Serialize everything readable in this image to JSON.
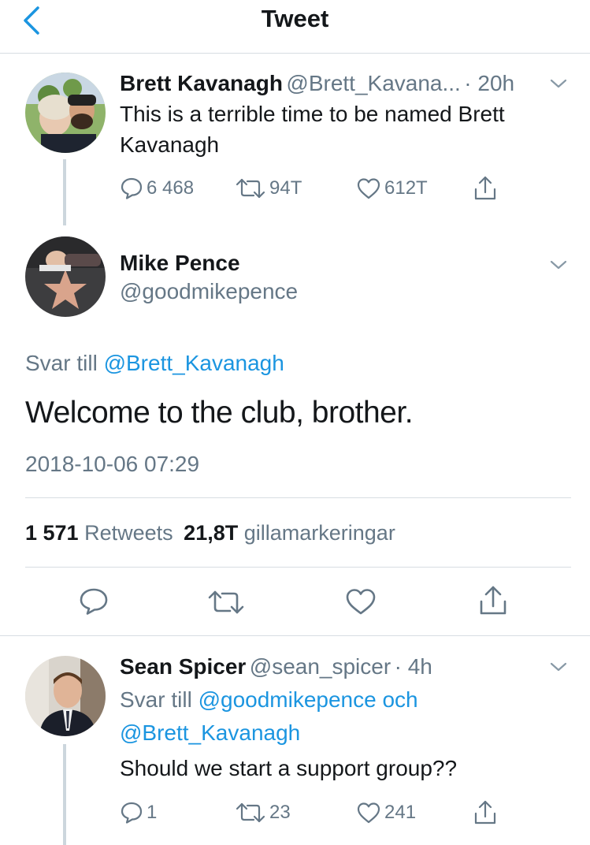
{
  "header": {
    "title": "Tweet"
  },
  "tweet1": {
    "name": "Brett Kavanagh",
    "handle": "@Brett_Kavana...",
    "time": "· 20h",
    "text": "This is a terrible time to be named Brett Kavanagh",
    "replies": "6 468",
    "retweets": "94T",
    "likes": "612T"
  },
  "main": {
    "name": "Mike Pence",
    "handle": "@goodmikepence",
    "reply_prefix": "Svar till",
    "reply_to": "@Brett_Kavanagh",
    "text": "Welcome to the club, brother.",
    "timestamp": "2018-10-06 07:29",
    "retweet_count": "1 571",
    "retweet_label": "Retweets",
    "like_count": "21,8T",
    "like_label": "gillamarkeringar"
  },
  "reply": {
    "name": "Sean Spicer",
    "handle": "@sean_spicer",
    "time": "· 4h",
    "reply_prefix": "Svar till",
    "reply_to_1": "@goodmikepence",
    "reply_and": "och",
    "reply_to_2": "@Brett_Kavanagh",
    "text": "Should we start a support group??",
    "replies": "1",
    "retweets": "23",
    "likes": "241"
  },
  "colors": {
    "link": "#1b95e0",
    "muted": "#657786",
    "divider": "#d7dde2"
  }
}
